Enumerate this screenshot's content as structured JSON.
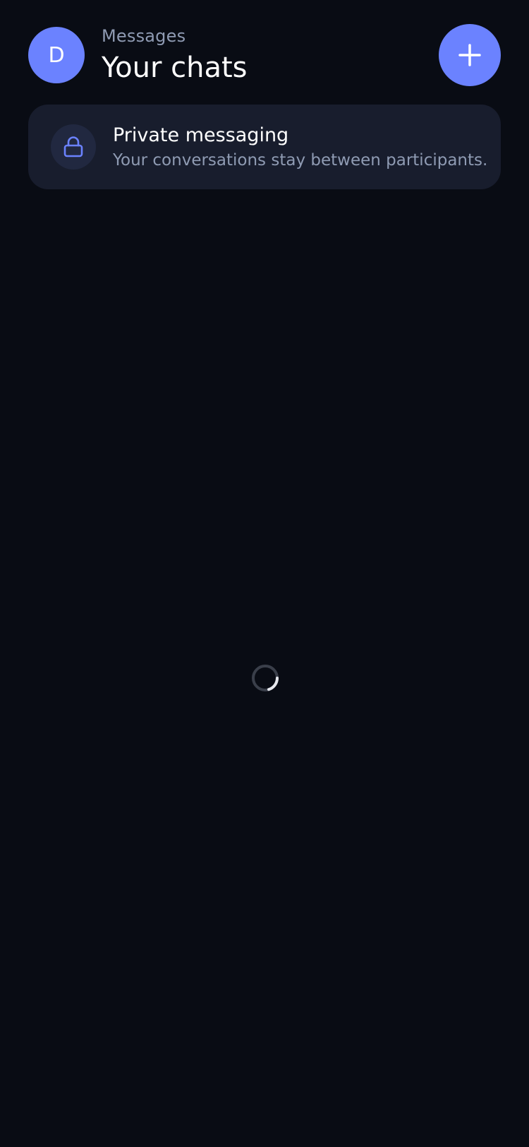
{
  "header": {
    "avatar_initial": "D",
    "subtitle": "Messages",
    "title": "Your chats",
    "new_chat_icon": "plus-icon"
  },
  "notice": {
    "icon": "lock-icon",
    "title": "Private messaging",
    "description": "Your conversations stay between participants."
  },
  "loading": {
    "icon": "loading-spinner"
  },
  "colors": {
    "background": "#090c14",
    "accent": "#6b82ff",
    "card": "#181d2d",
    "muted_text": "#8f9bb3"
  }
}
